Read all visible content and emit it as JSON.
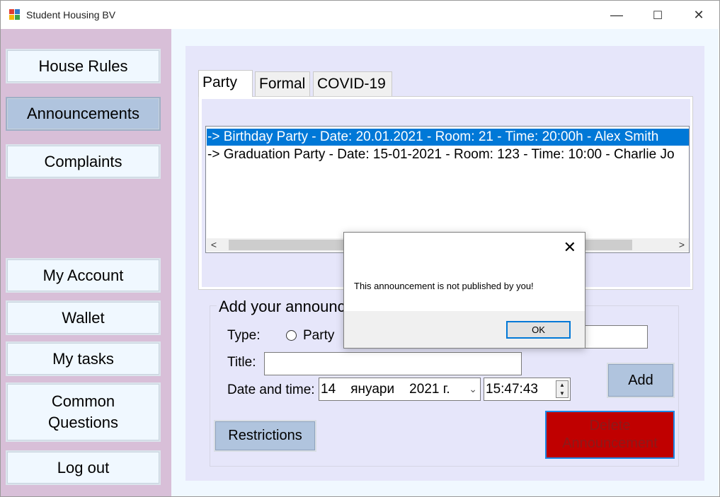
{
  "window": {
    "title": "Student Housing BV",
    "controls": {
      "minimize": "—",
      "maximize": "☐",
      "close": "✕"
    }
  },
  "sidebar": {
    "items": [
      {
        "label": "House Rules",
        "active": false
      },
      {
        "label": "Announcements",
        "active": true
      },
      {
        "label": "Complaints",
        "active": false
      },
      {
        "label": "My Account",
        "active": false
      },
      {
        "label": "Wallet",
        "active": false
      },
      {
        "label": "My tasks",
        "active": false
      },
      {
        "label_line1": "Common",
        "label_line2": "Questions",
        "active": false
      },
      {
        "label": "Log out",
        "active": false
      }
    ]
  },
  "tabs": [
    {
      "label": "Party",
      "active": true
    },
    {
      "label": "Formal",
      "active": false
    },
    {
      "label": "COVID-19",
      "active": false
    }
  ],
  "announcements": [
    {
      "text": "-> Birthday Party - Date: 20.01.2021 - Room: 21 - Time: 20:00h - Alex Smith",
      "selected": true
    },
    {
      "text": "-> Graduation Party - Date: 15-01-2021 - Room: 123 - Time: 10:00 - Charlie Jo",
      "selected": false
    }
  ],
  "scrollbar": {
    "left_arrow": "<",
    "right_arrow": ">"
  },
  "form": {
    "title": "Add your announcement",
    "type_label": "Type:",
    "type_option": "Party",
    "title_label": "Title:",
    "title_value": "",
    "datetime_label": "Date and time:",
    "date_value": "14    януари    2021 г.",
    "time_value": "15:47:43",
    "add_button": "Add",
    "restrictions_button": "Restrictions",
    "delete_button_line1": "Delete",
    "delete_button_line2": "Announcement"
  },
  "dialog": {
    "message": "This announcement is not published by you!",
    "ok_button": "OK",
    "close": "✕"
  },
  "colors": {
    "sidebar": "#d8bfd8",
    "panel": "#e6e6fa",
    "button": "#f0f8ff",
    "active_button": "#b0c4de",
    "selection": "#0078d7",
    "delete": "#c00000"
  }
}
